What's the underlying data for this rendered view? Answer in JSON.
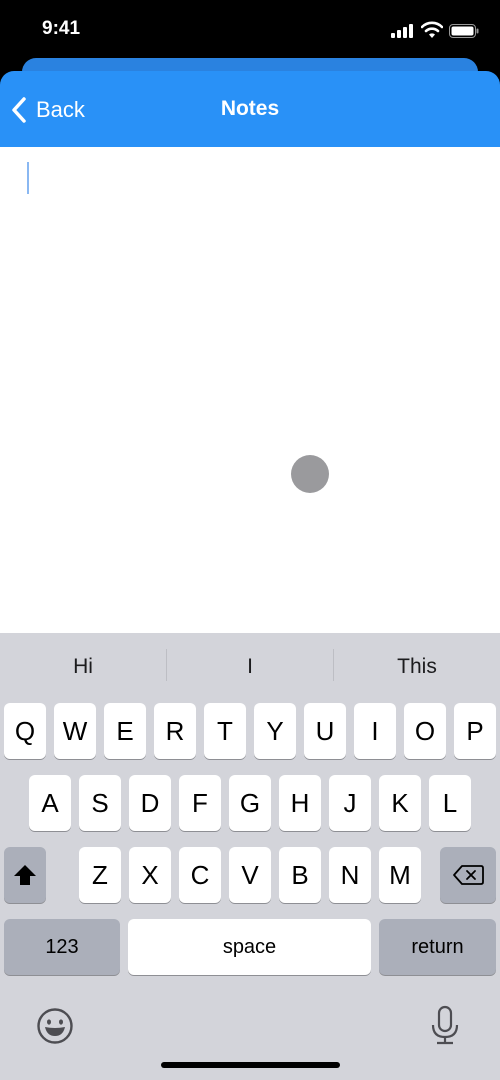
{
  "status_bar": {
    "time": "9:41",
    "icons": [
      "cellular-signal-icon",
      "wifi-icon",
      "battery-icon"
    ]
  },
  "nav": {
    "back_label": "Back",
    "title": "Notes",
    "color": "#2991f7"
  },
  "editor": {
    "text": ""
  },
  "keyboard": {
    "suggestions": [
      "Hi",
      "I",
      "This"
    ],
    "row1": [
      "Q",
      "W",
      "E",
      "R",
      "T",
      "Y",
      "U",
      "I",
      "O",
      "P"
    ],
    "row2": [
      "A",
      "S",
      "D",
      "F",
      "G",
      "H",
      "J",
      "K",
      "L"
    ],
    "row3": [
      "Z",
      "X",
      "C",
      "V",
      "B",
      "N",
      "M"
    ],
    "numbers_label": "123",
    "space_label": "space",
    "return_label": "return"
  }
}
